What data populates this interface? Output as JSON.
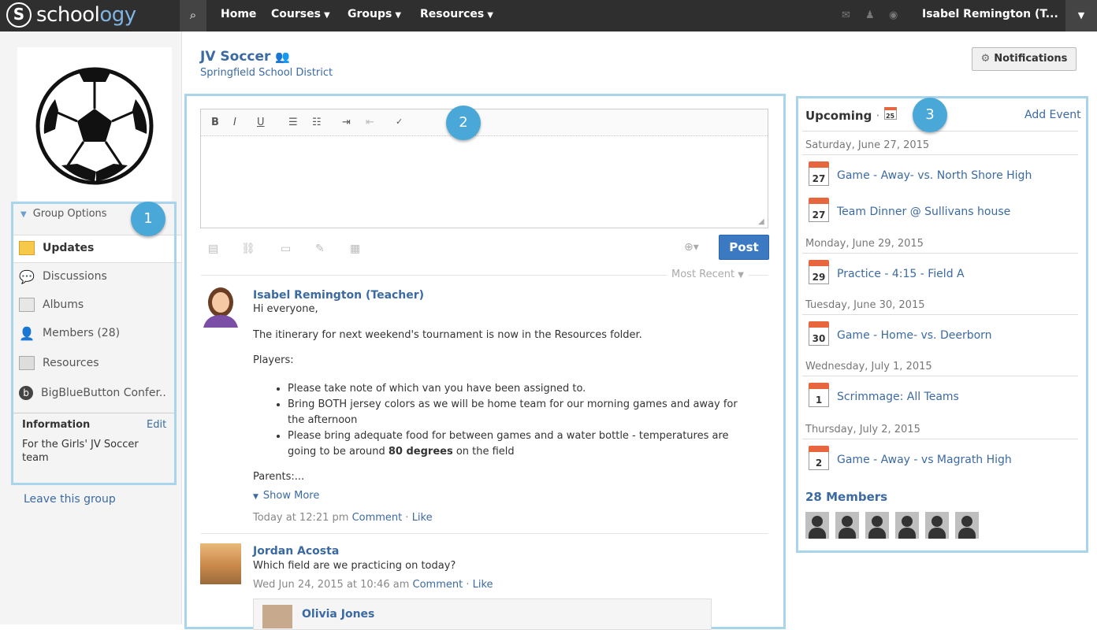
{
  "topbar": {
    "logo_mark": "S",
    "logo_word": "school",
    "logo_word_accent": "ogy",
    "nav": [
      "Home",
      "Courses",
      "Groups",
      "Resources"
    ],
    "user": "Isabel Remington (T..."
  },
  "group": {
    "title": "JV Soccer",
    "subtitle": "Springfield School District",
    "notifications_label": "Notifications"
  },
  "sidebar": {
    "group_options": "Group Options",
    "items": [
      {
        "label": "Updates"
      },
      {
        "label": "Discussions"
      },
      {
        "label": "Albums"
      },
      {
        "label": "Members (28)"
      },
      {
        "label": "Resources"
      },
      {
        "label": "BigBlueButton Confer.."
      }
    ],
    "info_title": "Information",
    "info_edit": "Edit",
    "info_text": "For the Girls' JV Soccer team",
    "leave": "Leave this group"
  },
  "badges": [
    "1",
    "2",
    "3"
  ],
  "composer": {
    "post_label": "Post",
    "sort_label": "Most Recent"
  },
  "posts": [
    {
      "author": "Isabel Remington (Teacher)",
      "greeting": "Hi everyone,",
      "p1": "The itinerary for next weekend's tournament is now in the Resources folder.",
      "players": "Players:",
      "bullet1": "Please take note of which van you have been assigned to.",
      "bullet2": "Bring BOTH jersey colors as we will be home team for our morning games and away for the afternoon",
      "bullet3a": "Please bring adequate food for between games and a water bottle - temperatures are going to be around ",
      "bullet3b": "80 degrees",
      "bullet3c": " on the field",
      "parents": "Parents:...",
      "show_more": "Show More",
      "time": "Today at 12:21 pm",
      "comment": "Comment",
      "like": "Like"
    },
    {
      "author": "Jordan Acosta",
      "text": "Which field are we practicing on today?",
      "time": "Wed Jun 24, 2015 at 10:46 am",
      "comment": "Comment",
      "like": "Like",
      "reply_author": "Olivia Jones"
    }
  ],
  "upcoming": {
    "title": "Upcoming",
    "cal_icon_day": "25",
    "add_event": "Add Event",
    "days": [
      {
        "date": "Saturday, June 27, 2015",
        "events": [
          {
            "day": "27",
            "title": "Game - Away- vs. North Shore High"
          },
          {
            "day": "27",
            "title": "Team Dinner @ Sullivans house"
          }
        ]
      },
      {
        "date": "Monday, June 29, 2015",
        "events": [
          {
            "day": "29",
            "title": "Practice - 4:15 - Field A"
          }
        ]
      },
      {
        "date": "Tuesday, June 30, 2015",
        "events": [
          {
            "day": "30",
            "title": "Game - Home- vs. Deerborn"
          }
        ]
      },
      {
        "date": "Wednesday, July 1, 2015",
        "events": [
          {
            "day": "1",
            "title": "Scrimmage: All Teams"
          }
        ]
      },
      {
        "date": "Thursday, July 2, 2015",
        "events": [
          {
            "day": "2",
            "title": "Game - Away - vs Magrath High"
          }
        ]
      }
    ],
    "members_title": "28 Members"
  }
}
